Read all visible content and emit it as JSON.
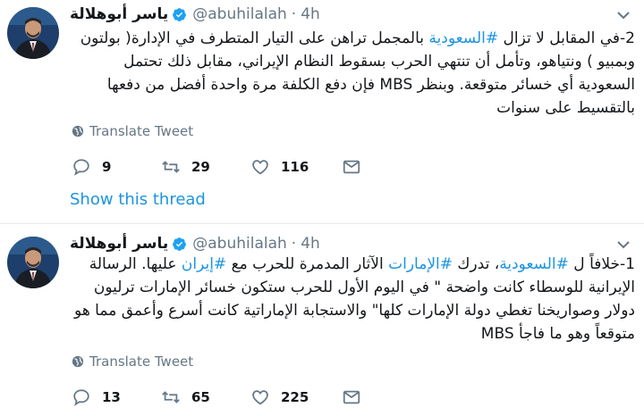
{
  "tweets": [
    {
      "author_name": "ياسر أبوهلالة",
      "handle": "@abuhilalah",
      "separator": "·",
      "time": "4h",
      "text_parts": [
        {
          "t": "2-في المقابل لا تزال ",
          "tag": false
        },
        {
          "t": "#السعودية",
          "tag": true
        },
        {
          "t": " بالمجمل تراهن على التيار المتطرف في الإدارة( بولتون وبمبيو ) ونتياهو، وتأمل أن تنتهي الحرب بسقوط النظام الإيراني، مقابل ذلك تحتمل السعودية أي خسائر متوقعة. وبنظر MBS فإن دفع الكلفة مرة واحدة أفضل من دفعها بالتقسيط على سنوات",
          "tag": false
        }
      ],
      "translate_label": "Translate Tweet",
      "replies": "9",
      "retweets": "29",
      "likes": "116",
      "show_thread": "Show this thread"
    },
    {
      "author_name": "ياسر أبوهلالة",
      "handle": "@abuhilalah",
      "separator": "·",
      "time": "4h",
      "text_parts": [
        {
          "t": "1-خلافاً ل ",
          "tag": false
        },
        {
          "t": "#السعودية",
          "tag": true
        },
        {
          "t": "، تدرك ",
          "tag": false
        },
        {
          "t": "#الإمارات",
          "tag": true
        },
        {
          "t": " الآثار المدمرة للحرب مع ",
          "tag": false
        },
        {
          "t": "#إيران",
          "tag": true
        },
        {
          "t": " عليها. الرسالة الإيرانية للوسطاء كانت واضحة \" في اليوم الأول للحرب ستكون خسائر الإمارات ترليون دولار وصواريخنا تغطي دولة الإمارات كلها\" والاستجابة الإماراتية كانت أسرع وأعمق مما هو متوقعاً وهو ما فاجأ MBS",
          "tag": false
        }
      ],
      "translate_label": "Translate Tweet",
      "replies": "13",
      "retweets": "65",
      "likes": "225"
    }
  ],
  "colors": {
    "link": "#1b95e0",
    "muted": "#657786",
    "text": "#14171a",
    "verified": "#1da1f2"
  },
  "icons": [
    "avatar",
    "verified-icon",
    "chevron-down-icon",
    "globe-icon",
    "reply-icon",
    "retweet-icon",
    "like-icon",
    "dm-icon"
  ]
}
